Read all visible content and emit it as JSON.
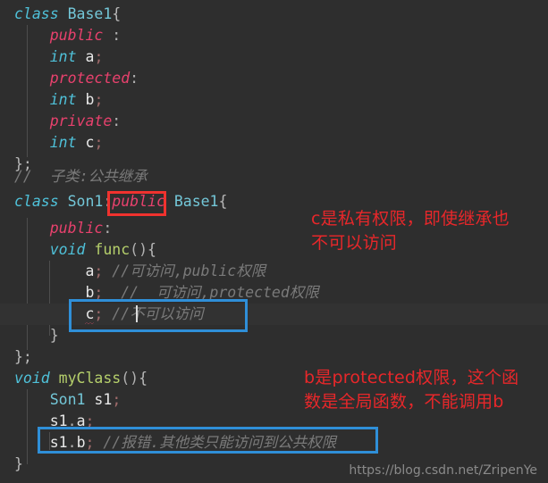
{
  "editor": {
    "background": "#2e2e2e",
    "highlight_line_background": "#323232",
    "lines": [
      {
        "n": 1,
        "indent": 0,
        "text": "class Base1{"
      },
      {
        "n": 2,
        "indent": 1,
        "text": "public :"
      },
      {
        "n": 3,
        "indent": 1,
        "text": "int a;"
      },
      {
        "n": 4,
        "indent": 1,
        "text": "protected:"
      },
      {
        "n": 5,
        "indent": 1,
        "text": "int b;"
      },
      {
        "n": 6,
        "indent": 1,
        "text": "private:"
      },
      {
        "n": 7,
        "indent": 1,
        "text": "int c;"
      },
      {
        "n": 8,
        "indent": 0,
        "text": "};"
      },
      {
        "n": 9,
        "indent": 0,
        "text": "//  子类:公共继承"
      },
      {
        "n": 10,
        "indent": 0,
        "text": "class Son1:public Base1{"
      },
      {
        "n": 11,
        "indent": 1,
        "text": "public:"
      },
      {
        "n": 12,
        "indent": 1,
        "text": "void func(){"
      },
      {
        "n": 13,
        "indent": 2,
        "text": "a; //可访问,public权限"
      },
      {
        "n": 14,
        "indent": 2,
        "text": "b;  //  可访问,protected权限"
      },
      {
        "n": 15,
        "indent": 2,
        "text": "c; //不可以访问"
      },
      {
        "n": 16,
        "indent": 1,
        "text": "}"
      },
      {
        "n": 17,
        "indent": 0,
        "text": "};"
      },
      {
        "n": 18,
        "indent": 0,
        "text": "void myClass(){"
      },
      {
        "n": 19,
        "indent": 1,
        "text": "Son1 s1;"
      },
      {
        "n": 20,
        "indent": 1,
        "text": "s1.a;"
      },
      {
        "n": 21,
        "indent": 1,
        "text": "s1.b; //报错.其他类只能访问到公共权限"
      },
      {
        "n": 22,
        "indent": 0,
        "text": "}"
      }
    ],
    "tokens": {
      "l1_class": "class",
      "l1_name": "Base1",
      "l1_brace": "{",
      "l2_access": "public",
      "l2_colon": " :",
      "l3_type": "int",
      "l3_name": " a",
      "l3_semi": ";",
      "l4_access": "protected",
      "l4_colon": ":",
      "l5_type": "int",
      "l5_name": " b",
      "l5_semi": ";",
      "l6_access": "private",
      "l6_colon": ":",
      "l7_type": "int",
      "l7_name": " c",
      "l7_semi": ";",
      "l8_close": "};",
      "l9_comment": "//  子类:公共继承",
      "l10_class": "class",
      "l10_name": " Son1",
      "l10_colon": ":",
      "l10_access": "public",
      "l10_base": " Base1",
      "l10_brace": "{",
      "l11_access": "public",
      "l11_colon": ":",
      "l12_void": "void",
      "l12_fn": " func",
      "l12_paren": "()",
      "l12_brace": "{",
      "l13_id": "a",
      "l13_semi": ";",
      "l13_comment": " //可访问,public权限",
      "l14_id": "b",
      "l14_semi": ";",
      "l14_comment": "  //  可访问,protected权限",
      "l15_id": "c",
      "l15_semi": ";",
      "l15_comment": " //不可以访问",
      "l16_close": "}",
      "l17_close": "};",
      "l18_void": "void",
      "l18_fn": " myClass",
      "l18_paren": "()",
      "l18_brace": "{",
      "l19_type": "Son1",
      "l19_id": " s1",
      "l19_semi": ";",
      "l20_id": "s1",
      "l20_dot": ".",
      "l20_member": "a",
      "l20_semi": ";",
      "l21_id": "s1",
      "l21_dot": ".",
      "l21_member": "b",
      "l21_semi": ";",
      "l21_comment": " //报错.其他类只能访问到公共权限",
      "l22_close": "}"
    }
  },
  "annotations": {
    "red_box_target": "public",
    "red_box_color": "#f0322e",
    "blue_box_color": "#2f8fd8",
    "notes": [
      {
        "id": "note-private-c",
        "text": "c是私有权限，即使继承也\n不可以访问",
        "color": "#e8272a"
      },
      {
        "id": "note-protected-b",
        "text": "b是protected权限，这个函\n数是全局函数，不能调用b",
        "color": "#e8272a"
      }
    ]
  },
  "watermark": {
    "text": "https://blog.csdn.net/ZripenYe"
  }
}
